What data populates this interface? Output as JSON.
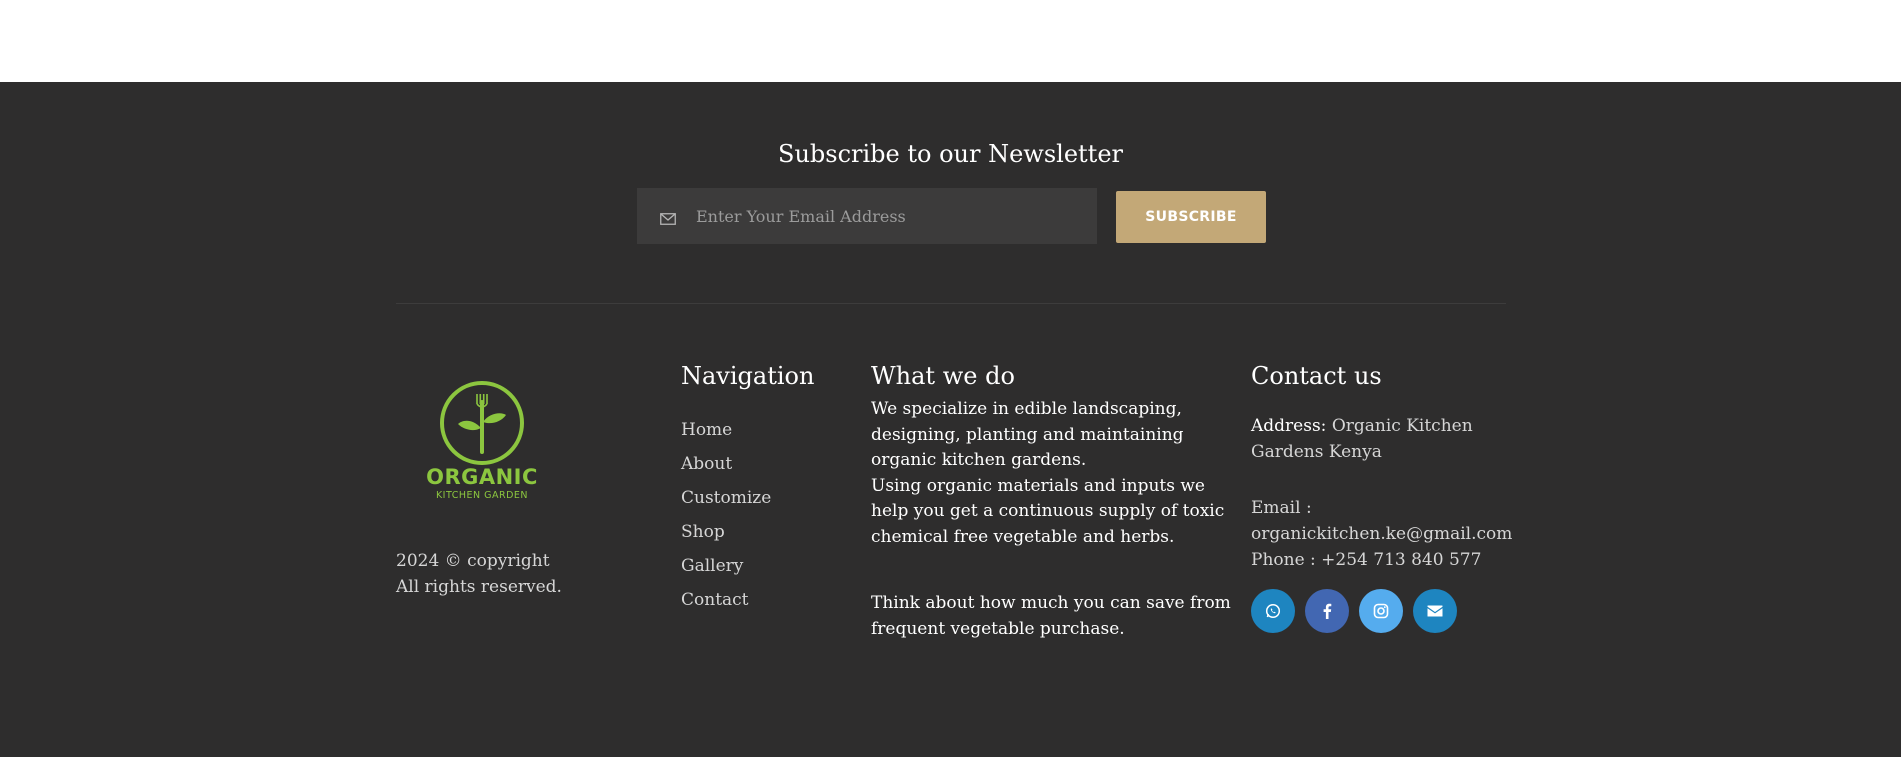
{
  "newsletter": {
    "title": "Subscribe to our Newsletter",
    "email_placeholder": "Enter Your Email Address",
    "subscribe_label": "SUBSCRIBE",
    "icon": "mail-icon"
  },
  "brand": {
    "logo_text": "ORGANIC",
    "logo_subtext": "KITCHEN GARDEN",
    "logo_color": "#8cc63f",
    "copyright_line1": "2024 © copyright",
    "copyright_line2": "All rights reserved."
  },
  "navigation": {
    "title": "Navigation",
    "items": [
      "Home",
      "About",
      "Customize",
      "Shop",
      "Gallery",
      "Contact"
    ]
  },
  "what_we_do": {
    "title": "What we do",
    "paragraph1": "We specialize in edible landscaping, designing, planting and maintaining organic kitchen gardens.",
    "paragraph2": "Using organic materials and inputs we help you get a continuous supply of toxic chemical free vegetable and herbs.",
    "paragraph3": "Think about how much you can save from frequent vegetable purchase."
  },
  "contact": {
    "title": "Contact us",
    "address_label": "Address:",
    "address_value": "Organic Kitchen Gardens Kenya",
    "email_label": "Email :",
    "email_value": "organickitchen.ke@gmail.com",
    "phone": "Phone : +254 713 840 577"
  },
  "social": [
    {
      "name": "whatsapp-icon",
      "color": "#1e85c0"
    },
    {
      "name": "facebook-icon",
      "color": "#4267b2"
    },
    {
      "name": "instagram-icon",
      "color": "#55acee"
    },
    {
      "name": "envelope-icon",
      "color": "#1e85c0"
    }
  ],
  "colors": {
    "footer_bg": "#2e2d2d",
    "accent": "#c3a877",
    "input_bg": "#3c3b3b"
  }
}
